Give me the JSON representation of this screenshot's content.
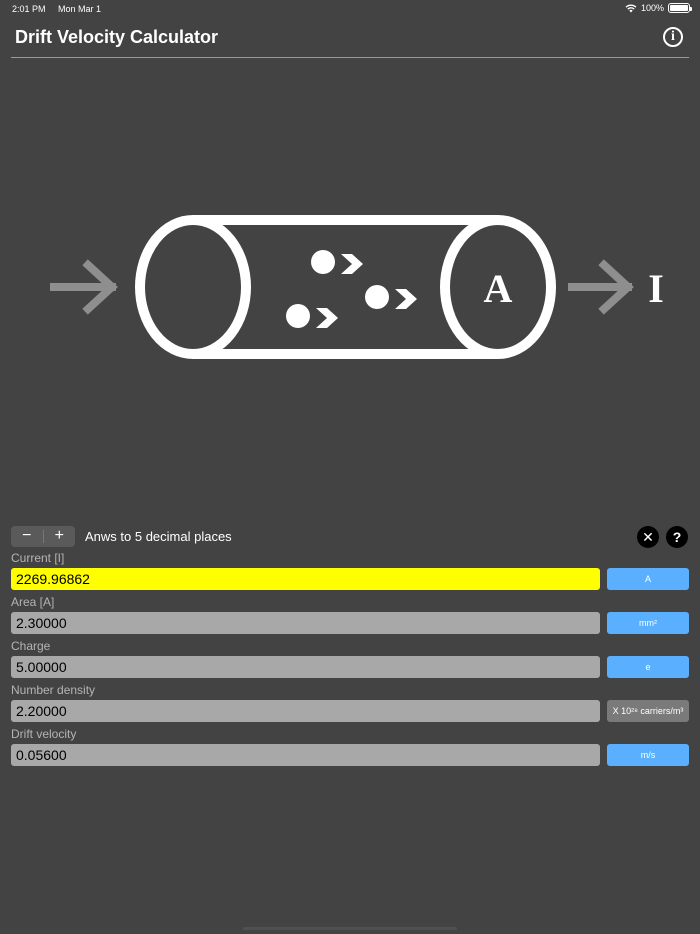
{
  "status": {
    "time": "2:01 PM",
    "date": "Mon Mar 1",
    "battery": "100%"
  },
  "header": {
    "title": "Drift Velocity Calculator",
    "info_icon": "info-icon"
  },
  "diagram": {
    "area_label": "A",
    "current_label": "I"
  },
  "controls": {
    "minus": "−",
    "plus": "+",
    "decimals_label": "Anws to 5 decimal places",
    "clear_icon": "✕",
    "help_icon": "?"
  },
  "fields": [
    {
      "label": "Current [I]",
      "value": "2269.96862",
      "unit": "A",
      "highlight": true
    },
    {
      "label": "Area [A]",
      "value": "2.30000",
      "unit": "mm²"
    },
    {
      "label": "Charge",
      "value": "5.00000",
      "unit": "e"
    },
    {
      "label": "Number density",
      "value": "2.20000",
      "unit": "X 10²⁸ carriers/m³"
    },
    {
      "label": "Drift velocity",
      "value": "0.05600",
      "unit": "m/s"
    }
  ],
  "colors": {
    "background": "#434343",
    "highlight": "#ffff00",
    "unit_button": "#5ab0ff",
    "input": "#a8a8a8"
  }
}
